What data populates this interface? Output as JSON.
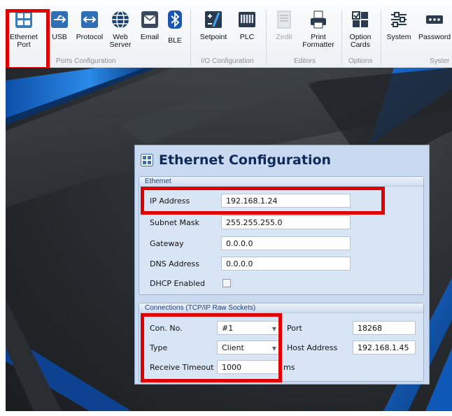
{
  "ribbon": {
    "groups": [
      {
        "label": "Ports Configuration"
      },
      {
        "label": "I/O Configuration"
      },
      {
        "label": "Editors"
      },
      {
        "label": "Options"
      },
      {
        "label": "Syster"
      }
    ],
    "buttons": {
      "ethernet_port": "Ethernet\nPort",
      "usb": "USB",
      "protocol": "Protocol",
      "web_server": "Web\nServer",
      "email": "Email",
      "ble": "BLE",
      "setpoint": "Setpoint",
      "plc": "PLC",
      "zedit": "Zedit",
      "print_formatter": "Print\nFormatter",
      "option_cards": "Option\nCards",
      "system": "System",
      "password": "Password"
    }
  },
  "dialog": {
    "title": "Ethernet Configuration",
    "ethernet": {
      "header": "Ethernet",
      "ip_address_label": "IP Address",
      "ip_address_value": "192.168.1.24",
      "subnet_label": "Subnet Mask",
      "subnet_value": "255.255.255.0",
      "gateway_label": "Gateway",
      "gateway_value": "0.0.0.0",
      "dns_label": "DNS Address",
      "dns_value": "0.0.0.0",
      "dhcp_label": "DHCP Enabled",
      "dhcp_enabled": false
    },
    "connections": {
      "header": "Connections (TCP/IP Raw Sockets)",
      "con_no_label": "Con. No.",
      "con_no_value": "#1",
      "port_label": "Port",
      "port_value": "18268",
      "type_label": "Type",
      "type_value": "Client",
      "host_label": "Host Address",
      "host_value": "192.168.1.45",
      "timeout_label": "Receive Timeout",
      "timeout_value": "1000",
      "timeout_unit": "ms"
    }
  },
  "colors": {
    "highlight": "#e00000",
    "dialog_bg": "#c9daf0",
    "title": "#102a5a",
    "accent_blue": "#1f6fd0"
  }
}
